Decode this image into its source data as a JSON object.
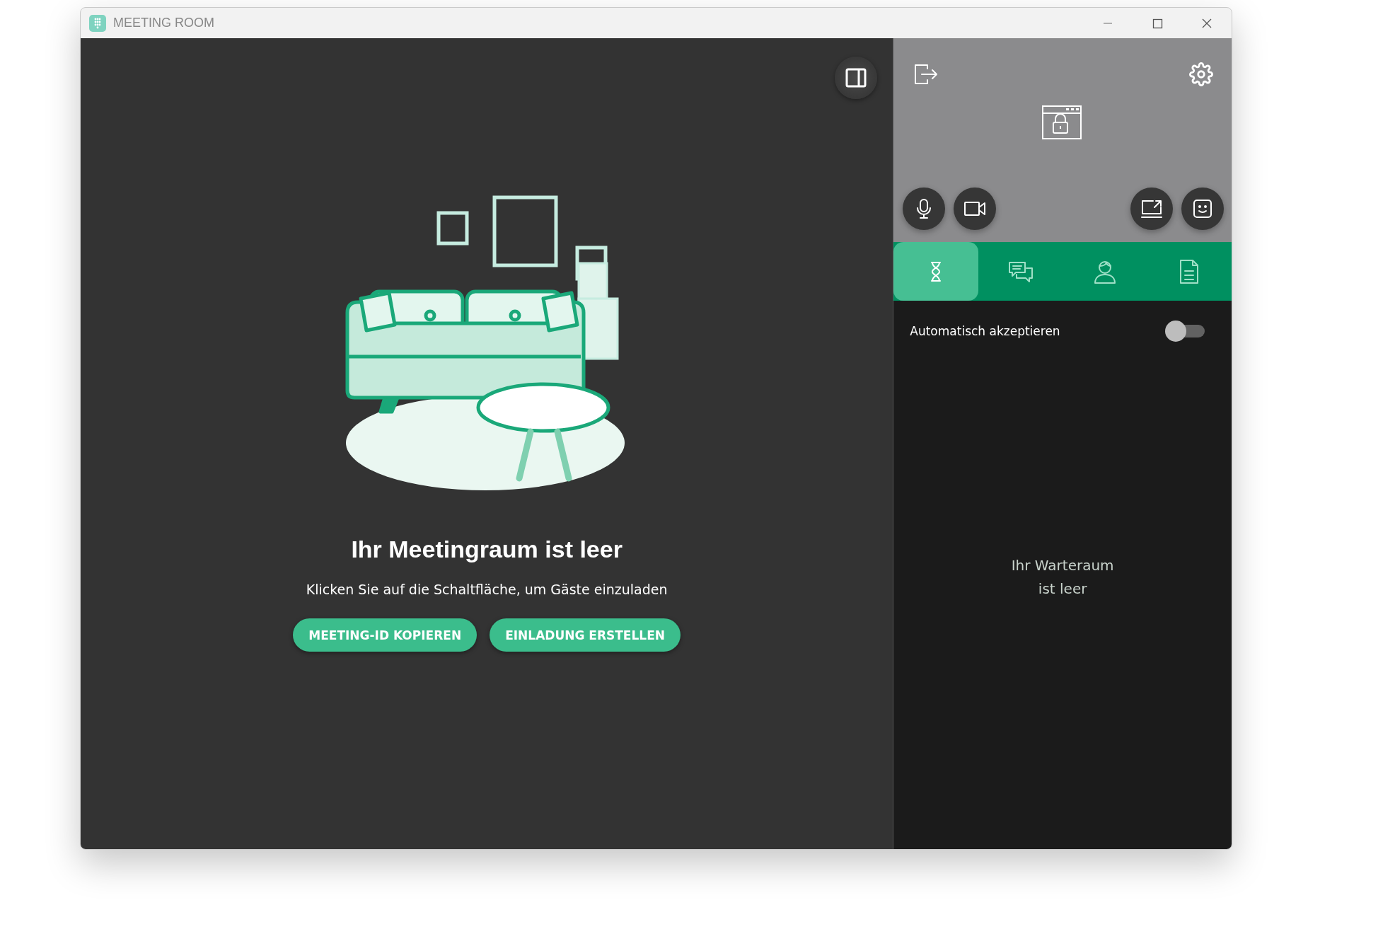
{
  "window": {
    "title": "MEETING ROOM"
  },
  "stage": {
    "title": "Ihr Meetingraum ist leer",
    "subtitle": "Klicken Sie auf die Schaltfläche, um Gäste einzuladen",
    "buttons": [
      {
        "label": "MEETING-ID KOPIEREN"
      },
      {
        "label": "EINLADUNG ERSTELLEN"
      }
    ]
  },
  "sidebar": {
    "tabs": [
      {
        "kind": "waiting",
        "selected": true
      },
      {
        "kind": "chat",
        "selected": false
      },
      {
        "kind": "person",
        "selected": false
      },
      {
        "kind": "document",
        "selected": false
      }
    ],
    "auto_accept": {
      "label": "Automatisch akzeptieren",
      "on": false
    },
    "empty_message": "Ihr Warteraum\nist leer"
  }
}
